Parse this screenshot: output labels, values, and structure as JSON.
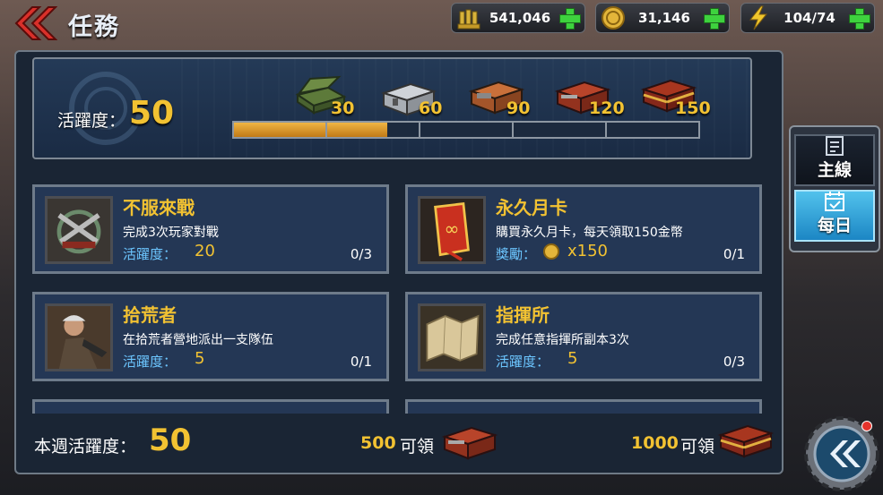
{
  "header": {
    "title": "任務"
  },
  "resources": [
    {
      "name": "ammo",
      "icon": "ammo-icon",
      "value": "541,046"
    },
    {
      "name": "gold",
      "icon": "gold-coin-icon",
      "value": "31,146"
    },
    {
      "name": "energy",
      "icon": "lightning-icon",
      "value": "104/74"
    }
  ],
  "activity": {
    "label": "活躍度：",
    "value": "50",
    "progress_fraction": 0.33,
    "milestones": [
      "30",
      "60",
      "90",
      "120",
      "150"
    ]
  },
  "tasks": [
    {
      "title": "不服來戰",
      "desc": "完成3次玩家對戰",
      "reward_label": "活躍度：",
      "reward_value": "20",
      "progress": "0/3",
      "icon": "crossed-guns-emblem-icon"
    },
    {
      "title": "永久月卡",
      "desc": "購買永久月卡，每天領取150金幣",
      "reward_label": "獎勵：",
      "reward_value": "x150",
      "progress": "0/1",
      "icon": "monthly-card-icon"
    },
    {
      "title": "拾荒者",
      "desc": "在拾荒者營地派出一支隊伍",
      "reward_label": "活躍度：",
      "reward_value": "5",
      "progress": "0/1",
      "icon": "scavenger-portrait-icon"
    },
    {
      "title": "指揮所",
      "desc": "完成任意指揮所副本3次",
      "reward_label": "活躍度：",
      "reward_value": "5",
      "progress": "0/3",
      "icon": "map-icon"
    }
  ],
  "footer": {
    "weekly_label": "本週活躍度：",
    "weekly_value": "50",
    "reward1_amount": "500",
    "reward1_label": "可領",
    "reward2_amount": "1000",
    "reward2_label": "可領"
  },
  "tabs": [
    {
      "label": "主線",
      "icon": "checklist-icon",
      "active": false
    },
    {
      "label": "每日",
      "icon": "calendar-icon",
      "active": true
    }
  ],
  "colors": {
    "accent_gold": "#f2c232",
    "reward_blue": "#6cc6ff",
    "plus_green": "#3ed23e"
  }
}
